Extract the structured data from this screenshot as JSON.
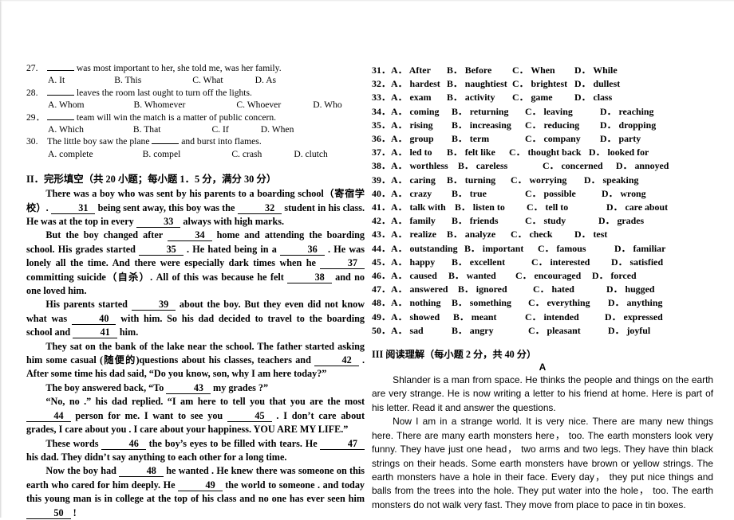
{
  "document": {
    "type": "english-exam-paper-scan"
  },
  "grammar_section": {
    "questions": [
      {
        "number": "27.",
        "stem_before": "",
        "has_leading_blank": true,
        "stem_after": "was most important to her, she told me, was her family.",
        "options": [
          {
            "letter": "A.",
            "text": "It"
          },
          {
            "letter": "B.",
            "text": "This"
          },
          {
            "letter": "C.",
            "text": "What"
          },
          {
            "letter": "D.",
            "text": "As"
          }
        ]
      },
      {
        "number": "28.",
        "stem_before": "",
        "has_leading_blank": true,
        "stem_after": "leaves the room last ought to turn off the lights.",
        "options": [
          {
            "letter": "A.",
            "text": "Whom"
          },
          {
            "letter": "B.",
            "text": "Whomever"
          },
          {
            "letter": "C.",
            "text": "Whoever"
          },
          {
            "letter": "D.",
            "text": "Who"
          }
        ]
      },
      {
        "number": "29．",
        "stem_before": "",
        "has_leading_blank": true,
        "stem_after": "team will win the match is a matter of public concern.",
        "options": [
          {
            "letter": "A.",
            "text": "Which"
          },
          {
            "letter": "B.",
            "text": "That"
          },
          {
            "letter": "C.",
            "text": "If"
          },
          {
            "letter": "D.",
            "text": "When"
          }
        ]
      },
      {
        "number": "30.",
        "stem_before": "The little boy saw the plane",
        "has_leading_blank": false,
        "stem_after": "and burst into flames.",
        "options": [
          {
            "letter": "A.",
            "text": "complete"
          },
          {
            "letter": "B.",
            "text": "compel"
          },
          {
            "letter": "C.",
            "text": "crash"
          },
          {
            "letter": "D.",
            "text": "clutch"
          }
        ]
      }
    ]
  },
  "cloze_section": {
    "heading": "II．完形填空（共 20 小题；每小题 1．5 分，满分 30 分）",
    "paragraphs": [
      [
        {
          "t": "text",
          "v": "There was a boy who was sent by his parents to a boarding school（寄宿学校）."
        },
        {
          "t": "blank",
          "v": "31"
        },
        {
          "t": "text",
          "v": "being sent away, this boy was the"
        },
        {
          "t": "blank",
          "v": "32"
        },
        {
          "t": "text",
          "v": "student in his class. He was at the top in every"
        },
        {
          "t": "blank",
          "v": "33"
        },
        {
          "t": "text",
          "v": "always with high marks."
        }
      ],
      [
        {
          "t": "text",
          "v": "But the boy changed after"
        },
        {
          "t": "blank",
          "v": "34"
        },
        {
          "t": "text",
          "v": "home and attending the boarding school. His grades started"
        },
        {
          "t": "blank",
          "v": "35"
        },
        {
          "t": "text",
          "v": ". He hated being in a"
        },
        {
          "t": "blank",
          "v": "36"
        },
        {
          "t": "text",
          "v": ". He was lonely all the time. And there were especially dark times when he"
        },
        {
          "t": "blank",
          "v": "37"
        },
        {
          "t": "text",
          "v": "committing suicide（自杀）. All of this was because he felt"
        },
        {
          "t": "blank",
          "v": "38"
        },
        {
          "t": "text",
          "v": "and no one loved him."
        }
      ],
      [
        {
          "t": "text",
          "v": "His parents started"
        },
        {
          "t": "blank",
          "v": "39"
        },
        {
          "t": "text",
          "v": "about the boy. But they even did not know what was"
        },
        {
          "t": "blank",
          "v": "40"
        },
        {
          "t": "text",
          "v": "with him. So his dad decided to travel to the boarding school and"
        },
        {
          "t": "blank",
          "v": "41"
        },
        {
          "t": "text",
          "v": "him."
        }
      ],
      [
        {
          "t": "text",
          "v": "They sat on the bank of the lake near the school. The father started asking him some casual (随便的)questions about his classes, teachers and"
        },
        {
          "t": "blank",
          "v": "42"
        },
        {
          "t": "text",
          "v": ". After some time his dad said, “Do you know, son, why I am here today?”"
        }
      ],
      [
        {
          "t": "text",
          "v": "The boy answered back, “To"
        },
        {
          "t": "blank",
          "v": "43"
        },
        {
          "t": "text",
          "v": "my grades ?”"
        }
      ],
      [
        {
          "t": "text",
          "v": "“No, no .” his dad replied. “I am here to tell you that you are the most"
        },
        {
          "t": "blank",
          "v": "44"
        },
        {
          "t": "text",
          "v": "person for me. I want to see you"
        },
        {
          "t": "blank",
          "v": "45"
        },
        {
          "t": "text",
          "v": ". I don’t care about grades, I care about you . I care about your happiness. YOU ARE MY LIFE.”"
        }
      ],
      [
        {
          "t": "text",
          "v": "These words"
        },
        {
          "t": "blank",
          "v": "46"
        },
        {
          "t": "text",
          "v": "the boy’s eyes to be filled with tears. He"
        },
        {
          "t": "blank",
          "v": "47"
        },
        {
          "t": "text",
          "v": "his dad. They didn’t say anything to each other for a long time."
        }
      ],
      [
        {
          "t": "text",
          "v": "Now the boy had"
        },
        {
          "t": "blank",
          "v": "48"
        },
        {
          "t": "text",
          "v": "he wanted . He knew there was someone on this earth who cared for him deeply. He"
        },
        {
          "t": "blank",
          "v": "49"
        },
        {
          "t": "text",
          "v": "the world to someone . and today this young man is in college at the top of his class and no one has ever seen him"
        },
        {
          "t": "blank",
          "v": "50"
        },
        {
          "t": "text",
          "v": "!"
        }
      ]
    ]
  },
  "cloze_options": [
    {
      "number": "31．",
      "options": [
        {
          "letter": "A．",
          "text": "After"
        },
        {
          "letter": "B．",
          "text": "Before"
        },
        {
          "letter": "C．",
          "text": "When"
        },
        {
          "letter": "D．",
          "text": "While"
        }
      ]
    },
    {
      "number": "32．",
      "options": [
        {
          "letter": "A．",
          "text": "hardest"
        },
        {
          "letter": "B．",
          "text": "naughtiest"
        },
        {
          "letter": "C．",
          "text": "brightest"
        },
        {
          "letter": "D．",
          "text": "dullest"
        }
      ]
    },
    {
      "number": "33．",
      "options": [
        {
          "letter": "A．",
          "text": "exam"
        },
        {
          "letter": "B．",
          "text": "activity"
        },
        {
          "letter": "C．",
          "text": "game"
        },
        {
          "letter": "D．",
          "text": "class"
        }
      ]
    },
    {
      "number": "34．",
      "options": [
        {
          "letter": "A．",
          "text": "coming"
        },
        {
          "letter": "B．",
          "text": "returning"
        },
        {
          "letter": "C．",
          "text": "leaving"
        },
        {
          "letter": "D．",
          "text": "reaching"
        }
      ]
    },
    {
      "number": "35．",
      "options": [
        {
          "letter": "A．",
          "text": "rising"
        },
        {
          "letter": "B．",
          "text": "increasing"
        },
        {
          "letter": "C．",
          "text": "reducing"
        },
        {
          "letter": "D．",
          "text": "dropping"
        }
      ]
    },
    {
      "number": "36．",
      "options": [
        {
          "letter": "A．",
          "text": "group"
        },
        {
          "letter": "B．",
          "text": "term"
        },
        {
          "letter": "C．",
          "text": "company"
        },
        {
          "letter": "D．",
          "text": "party"
        }
      ]
    },
    {
      "number": "37．",
      "options": [
        {
          "letter": "A．",
          "text": "led to"
        },
        {
          "letter": "B．",
          "text": "felt like"
        },
        {
          "letter": "C．",
          "text": "thought back"
        },
        {
          "letter": "D．",
          "text": "looked for"
        }
      ]
    },
    {
      "number": "38．",
      "options": [
        {
          "letter": "A．",
          "text": "worthless"
        },
        {
          "letter": "B．",
          "text": "careless"
        },
        {
          "letter": "C．",
          "text": "concerned"
        },
        {
          "letter": "D．",
          "text": "annoyed"
        }
      ]
    },
    {
      "number": "39．",
      "options": [
        {
          "letter": "A．",
          "text": "caring"
        },
        {
          "letter": "B．",
          "text": "turning"
        },
        {
          "letter": "C．",
          "text": "worrying"
        },
        {
          "letter": "D．",
          "text": "speaking"
        }
      ]
    },
    {
      "number": "40．",
      "options": [
        {
          "letter": "A．",
          "text": "crazy"
        },
        {
          "letter": "B．",
          "text": "true"
        },
        {
          "letter": "C．",
          "text": "possible"
        },
        {
          "letter": "D．",
          "text": "wrong"
        }
      ]
    },
    {
      "number": "41．",
      "options": [
        {
          "letter": "A．",
          "text": "talk with"
        },
        {
          "letter": "B．",
          "text": "listen to"
        },
        {
          "letter": "C．",
          "text": "tell to"
        },
        {
          "letter": "D．",
          "text": "care about"
        }
      ]
    },
    {
      "number": "42．",
      "options": [
        {
          "letter": "A．",
          "text": "family"
        },
        {
          "letter": "B．",
          "text": "friends"
        },
        {
          "letter": "C．",
          "text": "study"
        },
        {
          "letter": "D．",
          "text": "grades"
        }
      ]
    },
    {
      "number": "43．",
      "options": [
        {
          "letter": "A．",
          "text": "realize"
        },
        {
          "letter": "B．",
          "text": "analyze"
        },
        {
          "letter": "C．",
          "text": "check"
        },
        {
          "letter": "D．",
          "text": "test"
        }
      ]
    },
    {
      "number": "44．",
      "options": [
        {
          "letter": "A．",
          "text": "outstanding"
        },
        {
          "letter": "B．",
          "text": "important"
        },
        {
          "letter": "C．",
          "text": "famous"
        },
        {
          "letter": "D．",
          "text": "familiar"
        }
      ]
    },
    {
      "number": "45．",
      "options": [
        {
          "letter": "A．",
          "text": "happy"
        },
        {
          "letter": "B．",
          "text": "excellent"
        },
        {
          "letter": "C．",
          "text": "interested"
        },
        {
          "letter": "D．",
          "text": "satisfied"
        }
      ]
    },
    {
      "number": "46．",
      "options": [
        {
          "letter": "A．",
          "text": "caused"
        },
        {
          "letter": "B．",
          "text": "wanted"
        },
        {
          "letter": "C．",
          "text": "encouraged"
        },
        {
          "letter": "D．",
          "text": "forced"
        }
      ]
    },
    {
      "number": "47．",
      "options": [
        {
          "letter": "A．",
          "text": "answered"
        },
        {
          "letter": "B．",
          "text": "ignored"
        },
        {
          "letter": "C．",
          "text": "hated"
        },
        {
          "letter": "D．",
          "text": "hugged"
        }
      ]
    },
    {
      "number": "48．",
      "options": [
        {
          "letter": "A．",
          "text": "nothing"
        },
        {
          "letter": "B．",
          "text": "something"
        },
        {
          "letter": "C．",
          "text": "everything"
        },
        {
          "letter": "D．",
          "text": "anything"
        }
      ]
    },
    {
      "number": "49．",
      "options": [
        {
          "letter": "A．",
          "text": "showed"
        },
        {
          "letter": "B．",
          "text": "meant"
        },
        {
          "letter": "C．",
          "text": "intended"
        },
        {
          "letter": "D．",
          "text": "expressed"
        }
      ]
    },
    {
      "number": "50．",
      "options": [
        {
          "letter": "A．",
          "text": "sad"
        },
        {
          "letter": "B．",
          "text": "angry"
        },
        {
          "letter": "C．",
          "text": "pleasant"
        },
        {
          "letter": "D．",
          "text": "joyful"
        }
      ]
    }
  ],
  "reading_section": {
    "heading": "III  阅读理解（每小题 2 分，共 40 分）",
    "passage_letter": "A",
    "paragraphs": [
      "Shlander is a man from space. He thinks the people and things on the earth are very strange. He is now writing a letter to his friend at home. Here is part of his letter. Read it and answer the questions.",
      "Now I am in a strange world. It is very nice. There are many new things here. There are many earth monsters here，  too. The earth monsters look very funny. They have just one head，  two arms and two legs. They have thin black strings on their heads. Some earth monsters have brown or yellow strings. The earth monsters have a hole in their face. Every day，  they put nice things and balls from the trees into the hole. They put water into the hole，  too. The earth monsters do not walk very fast. They move from place to pace in tin boxes."
    ]
  }
}
